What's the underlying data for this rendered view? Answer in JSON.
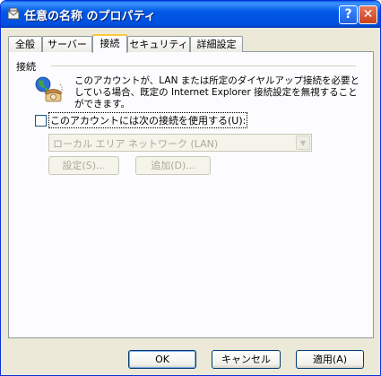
{
  "window": {
    "title": "任意の名称 のプロパティ",
    "help_label": "?",
    "close_label": "✕"
  },
  "tabs": [
    {
      "label": "全般",
      "active": false
    },
    {
      "label": "サーバー",
      "active": false
    },
    {
      "label": "接続",
      "active": true
    },
    {
      "label": "セキュリティ",
      "active": false
    },
    {
      "label": "詳細設定",
      "active": false
    }
  ],
  "connection": {
    "group_label": "接続",
    "description": "このアカウントが、LAN または所定のダイヤルアップ接続を必要としている場合、既定の Internet Explorer 接続設定を無視することができます。",
    "checkbox_label": "このアカウントには次の接続を使用する(U):",
    "checkbox_checked": false,
    "connection_select_value": "ローカル エリア ネットワーク (LAN)",
    "settings_button": "設定(S)...",
    "add_button": "追加(D)..."
  },
  "footer": {
    "ok": "OK",
    "cancel": "キャンセル",
    "apply": "適用(A)"
  },
  "icons": {
    "title": "mail-properties-icon",
    "connection": "globe-phone-icon"
  }
}
